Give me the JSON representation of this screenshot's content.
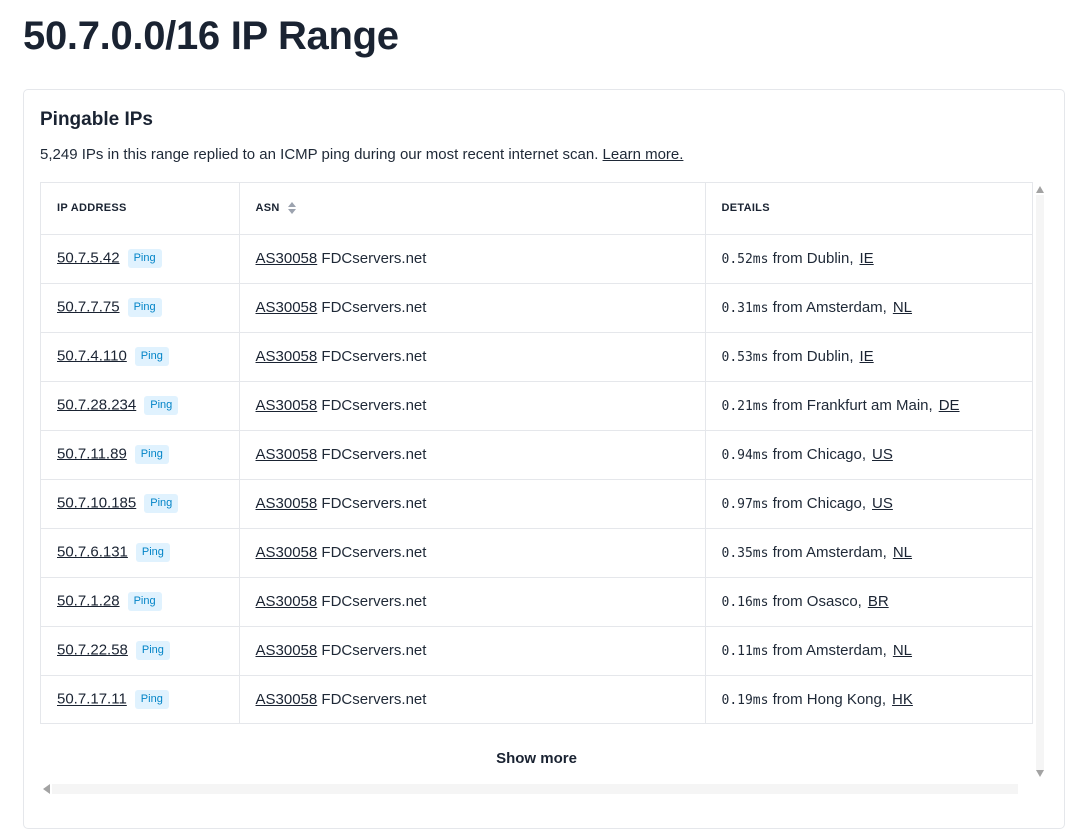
{
  "page": {
    "title": "50.7.0.0/16 IP Range"
  },
  "card": {
    "heading": "Pingable IPs",
    "description": "5,249 IPs in this range replied to an ICMP ping during our most recent internet scan.",
    "learn_more": "Learn more."
  },
  "table": {
    "headers": {
      "ip": "IP ADDRESS",
      "asn": "ASN",
      "details": "DETAILS"
    },
    "ping_label": "Ping",
    "rows": [
      {
        "ip": "50.7.5.42",
        "asn": "AS30058",
        "org": "FDCservers.net",
        "latency": "0.52ms",
        "city": "from Dublin,",
        "country": "IE"
      },
      {
        "ip": "50.7.7.75",
        "asn": "AS30058",
        "org": "FDCservers.net",
        "latency": "0.31ms",
        "city": "from Amsterdam,",
        "country": "NL"
      },
      {
        "ip": "50.7.4.110",
        "asn": "AS30058",
        "org": "FDCservers.net",
        "latency": "0.53ms",
        "city": "from Dublin,",
        "country": "IE"
      },
      {
        "ip": "50.7.28.234",
        "asn": "AS30058",
        "org": "FDCservers.net",
        "latency": "0.21ms",
        "city": "from Frankfurt am Main,",
        "country": "DE"
      },
      {
        "ip": "50.7.11.89",
        "asn": "AS30058",
        "org": "FDCservers.net",
        "latency": "0.94ms",
        "city": "from Chicago,",
        "country": "US"
      },
      {
        "ip": "50.7.10.185",
        "asn": "AS30058",
        "org": "FDCservers.net",
        "latency": "0.97ms",
        "city": "from Chicago,",
        "country": "US"
      },
      {
        "ip": "50.7.6.131",
        "asn": "AS30058",
        "org": "FDCservers.net",
        "latency": "0.35ms",
        "city": "from Amsterdam,",
        "country": "NL"
      },
      {
        "ip": "50.7.1.28",
        "asn": "AS30058",
        "org": "FDCservers.net",
        "latency": "0.16ms",
        "city": "from Osasco,",
        "country": "BR"
      },
      {
        "ip": "50.7.22.58",
        "asn": "AS30058",
        "org": "FDCservers.net",
        "latency": "0.11ms",
        "city": "from Amsterdam,",
        "country": "NL"
      },
      {
        "ip": "50.7.17.11",
        "asn": "AS30058",
        "org": "FDCservers.net",
        "latency": "0.19ms",
        "city": "from Hong Kong,",
        "country": "HK"
      }
    ]
  },
  "show_more": "Show more",
  "icons": {
    "sort": "sort-icon",
    "scroll_up": "arrow-up-icon",
    "scroll_down": "arrow-down-icon",
    "scroll_left": "arrow-left-icon"
  },
  "colors": {
    "badge_bg": "#e0f2fe",
    "badge_text": "#0284c7",
    "heading": "#1a2332"
  }
}
